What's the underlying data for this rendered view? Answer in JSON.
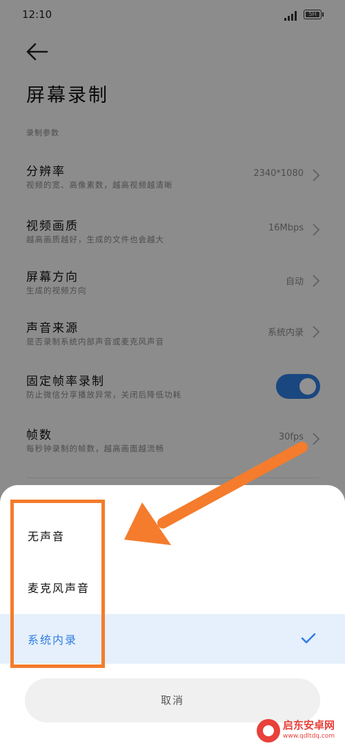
{
  "status_bar": {
    "time": "12:10",
    "battery_label": "5H"
  },
  "page": {
    "title": "屏幕录制",
    "section_label": "录制参数"
  },
  "settings": [
    {
      "title": "分辨率",
      "subtitle": "视频的宽、高像素数，越高视频越清晰",
      "value": "2340*1080"
    },
    {
      "title": "视频画质",
      "subtitle": "越高画质越好，生成的文件也会越大",
      "value": "16Mbps"
    },
    {
      "title": "屏幕方向",
      "subtitle": "生成的视频方向",
      "value": "自动"
    },
    {
      "title": "声音来源",
      "subtitle": "是否录制系统内部声音或麦克风声音",
      "value": "系统内录"
    },
    {
      "title": "固定帧率录制",
      "subtitle": "防止微信分享播放异常，关闭后降低功耗",
      "toggle_on": true
    },
    {
      "title": "帧数",
      "subtitle": "每秒钟录制的帧数，越高画面越流畅",
      "value": "30fps"
    }
  ],
  "sheet": {
    "options": [
      {
        "label": "无声音",
        "selected": false
      },
      {
        "label": "麦克风声音",
        "selected": false
      },
      {
        "label": "系统内录",
        "selected": true
      }
    ],
    "cancel_label": "取消"
  },
  "watermark": {
    "name": "启东安卓网",
    "url": "www.qdltdq.com"
  },
  "colors": {
    "accent": "#2f7de1",
    "annotation": "#f47c2c",
    "watermark": "#e8403a"
  }
}
